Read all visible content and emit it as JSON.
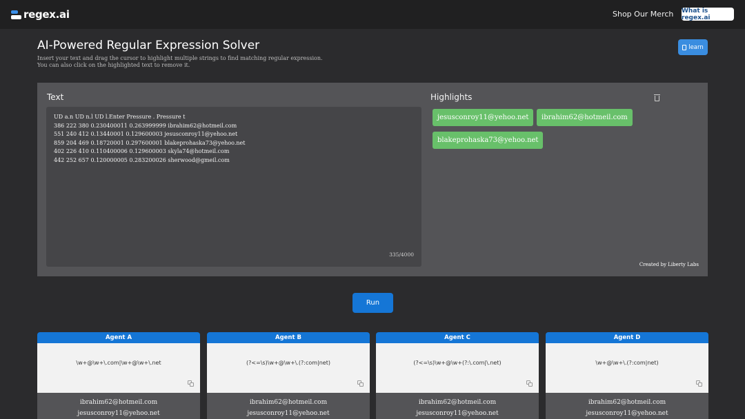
{
  "header": {
    "logo_text": "regex.ai",
    "merch_link": "Shop Our Merch",
    "what_is_button": "What is regex.ai"
  },
  "intro": {
    "title": "AI-Powered Regular Expression Solver",
    "subtitle_line1": "Insert your text and drag the cursor to highlight multiple strings to find matching regular expression.",
    "subtitle_line2": "You can also click on the highlighted text to remove it.",
    "learn_button": "learn"
  },
  "editor": {
    "text_label": "Text",
    "highlights_label": "Highlights",
    "lines": [
      "UD a.n UD n.l UD l.Enter Pressure . Pressure t",
      "386 222 380 0.230400011 0.263999999 ibrahim62@hotmeil.com",
      "551 240 412 0.13440001 0.129600003 jesusconroy11@yehoo.net",
      "859 204 469 0.18720001 0.297600001 blakeprohaska73@yehoo.net",
      "402 226 410 0.110400006 0.129600003 skyla74@hotmeil.com",
      "442 252 657 0.120000005 0.283200026 sherwood@gmeil.com"
    ],
    "counter": "335/4000",
    "highlights": [
      "jesusconroy11@yehoo.net",
      "ibrahim62@hotmeil.com",
      "blakeprohaska73@yehoo.net"
    ],
    "credit": "Created by Liberty Labs"
  },
  "run_button": "Run",
  "agents": [
    {
      "name": "Agent A",
      "regex": "\\w+@\\w+\\.com|\\w+@\\w+\\.net",
      "results": [
        "ibrahim62@hotmeil.com",
        "jesusconroy11@yehoo.net"
      ]
    },
    {
      "name": "Agent B",
      "regex": "(?<=\\s)\\w+@\\w+\\.(?:com|net)",
      "results": [
        "ibrahim62@hotmeil.com",
        "jesusconroy11@yehoo.net"
      ]
    },
    {
      "name": "Agent C",
      "regex": "(?<=\\s)\\w+@\\w+(?:\\.com|\\.net)",
      "results": [
        "ibrahim62@hotmeil.com",
        "jesusconroy11@yehoo.net"
      ]
    },
    {
      "name": "Agent D",
      "regex": "\\w+@\\w+\\.(?:com|net)",
      "results": [
        "ibrahim62@hotmeil.com",
        "jesusconroy11@yehoo.net"
      ]
    }
  ],
  "colors": {
    "accent": "#1576d6",
    "highlight_chip": "#68c06a",
    "panel": "#545457",
    "background": "#2b2b2d"
  }
}
